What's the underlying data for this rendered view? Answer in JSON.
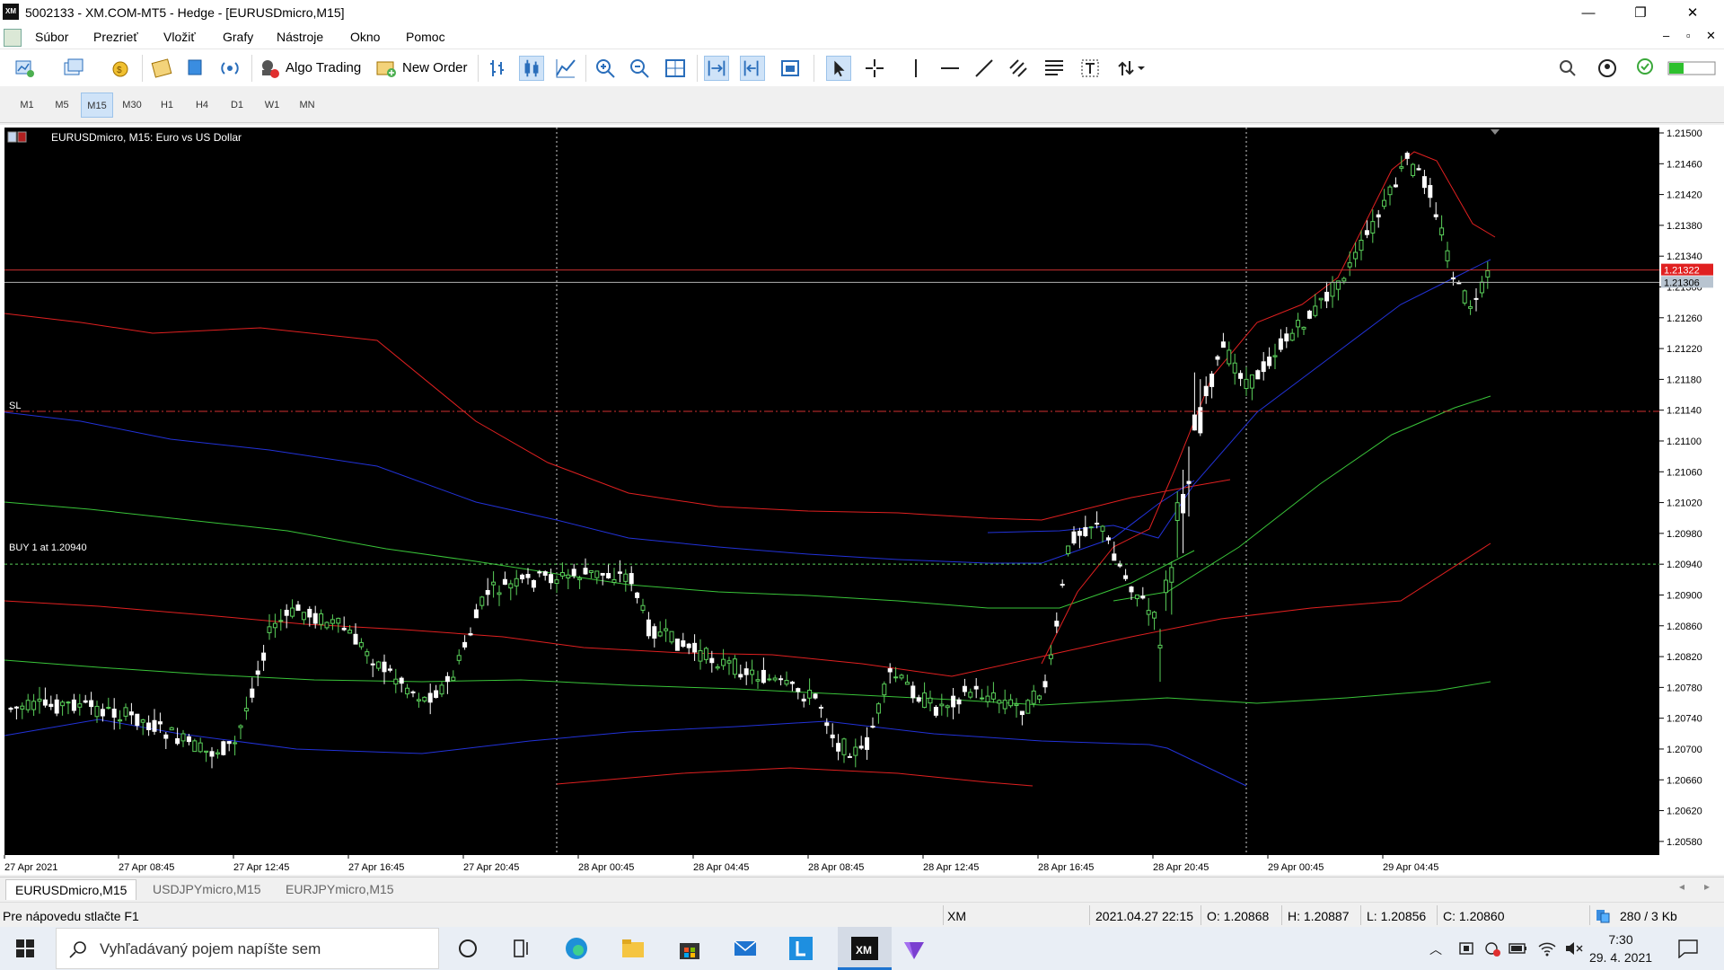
{
  "window": {
    "title": "5002133 - XM.COM-MT5 - Hedge - [EURUSDmicro,M15]",
    "logo": "XM",
    "controls": [
      "—",
      "❐",
      "✕"
    ]
  },
  "menu": {
    "items": [
      "Súbor",
      "Prezrieť",
      "Vložiť",
      "Grafy",
      "Nástroje",
      "Okno",
      "Pomoc"
    ],
    "mdi_controls": [
      "–",
      "▫",
      "✕"
    ]
  },
  "toolbar": {
    "algo_trading": "Algo Trading",
    "new_order": "New Order"
  },
  "timeframes": {
    "items": [
      "M1",
      "M5",
      "M15",
      "M30",
      "H1",
      "H4",
      "D1",
      "W1",
      "MN"
    ],
    "active": "M15"
  },
  "chart": {
    "header": "EURUSDmicro, M15:  Euro vs US Dollar",
    "sl_label": "SL",
    "buy_label": "BUY 1 at 1.20940",
    "price_labels": [
      "1.21500",
      "1.21460",
      "1.21420",
      "1.21380",
      "1.21340",
      "1.21300",
      "1.21260",
      "1.21220",
      "1.21180",
      "1.21140",
      "1.21100",
      "1.21060",
      "1.21020",
      "1.20980",
      "1.20940",
      "1.20900",
      "1.20860",
      "1.20820",
      "1.20780",
      "1.20740",
      "1.20700",
      "1.20660",
      "1.20620",
      "1.20580"
    ],
    "ask_tag": "1.21322",
    "bid_tag": "1.21306",
    "time_labels": [
      "27 Apr 2021",
      "27 Apr 08:45",
      "27 Apr 12:45",
      "27 Apr 16:45",
      "27 Apr 20:45",
      "28 Apr 00:45",
      "28 Apr 04:45",
      "28 Apr 08:45",
      "28 Apr 12:45",
      "28 Apr 16:45",
      "28 Apr 20:45",
      "29 Apr 00:45",
      "29 Apr 04:45"
    ],
    "colors": {
      "bull": "#5ad05a",
      "bear": "#ffffff",
      "ma_red": "#e02020",
      "ma_blue": "#2232d8",
      "ma_green": "#39c439",
      "bg": "#000000"
    }
  },
  "chart_tabs": [
    "EURUSDmicro,M15",
    "USDJPYmicro,M15",
    "EURJPYmicro,M15"
  ],
  "status": {
    "help": "Pre nápovedu stlačte F1",
    "broker": "XM",
    "datetime": "2021.04.27 22:15",
    "open": "O: 1.20868",
    "high": "H: 1.20887",
    "low": "L: 1.20856",
    "close": "C: 1.20860",
    "traffic": "280 / 3 Kb"
  },
  "taskbar": {
    "search_placeholder": "Vyhľadávaný pojem napíšte sem",
    "time": "7:30",
    "date": "29. 4. 2021"
  }
}
